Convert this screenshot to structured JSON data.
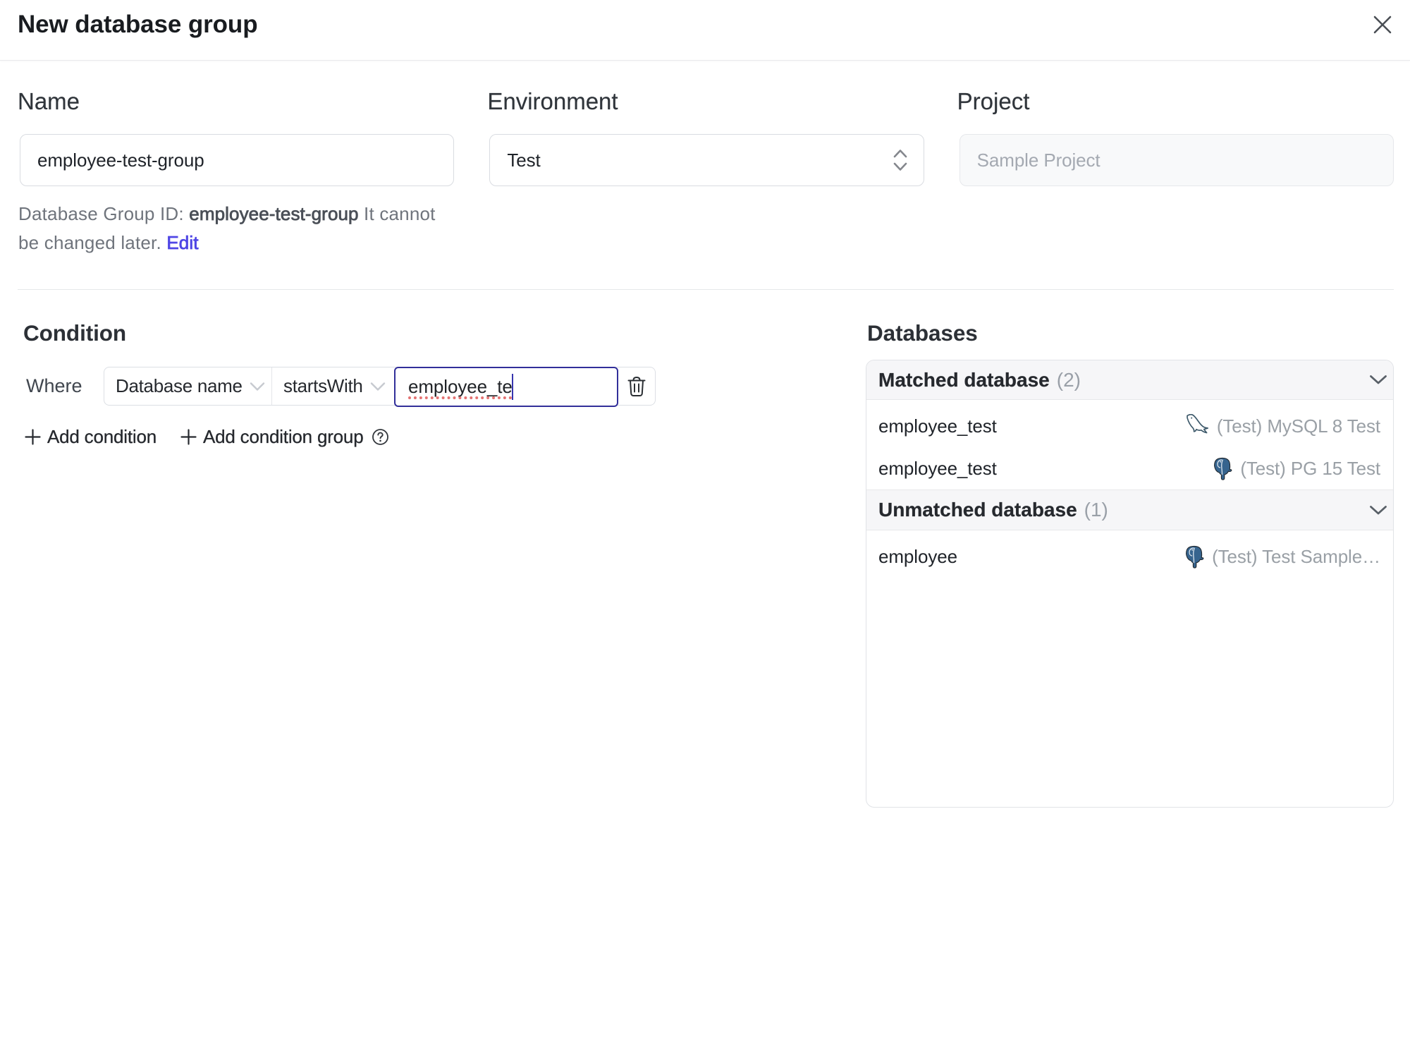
{
  "dialog": {
    "title": "New database group"
  },
  "form": {
    "name": {
      "label": "Name",
      "value": "employee-test-group"
    },
    "environment": {
      "label": "Environment",
      "value": "Test"
    },
    "project": {
      "label": "Project",
      "value": "Sample Project"
    },
    "group_id_note": {
      "prefix": "Database Group ID: ",
      "id": "employee-test-group",
      "suffix": " It cannot be changed later. ",
      "edit_label": "Edit"
    }
  },
  "condition": {
    "heading": "Condition",
    "where_label": "Where",
    "field_value": "Database name",
    "operator_value": "startsWith",
    "value": "employee_te",
    "add_condition_label": "Add condition",
    "add_condition_group_label": "Add condition group"
  },
  "databases": {
    "heading": "Databases",
    "sections": [
      {
        "title": "Matched database",
        "count": "(2)",
        "rows": [
          {
            "name": "employee_test",
            "engine": "mysql",
            "instance": "(Test) MySQL 8 Test"
          },
          {
            "name": "employee_test",
            "engine": "postgresql",
            "instance": "(Test) PG 15 Test"
          }
        ]
      },
      {
        "title": "Unmatched database",
        "count": "(1)",
        "rows": [
          {
            "name": "employee",
            "engine": "postgresql",
            "instance": "(Test) Test Sample…"
          }
        ]
      }
    ]
  },
  "colors": {
    "accent": "#4f46e5",
    "focus_border": "#322f9a",
    "spellcheck": "#e47272",
    "mysql_icon": "#3f5c6e",
    "postgres_icon": "#3a6b96"
  }
}
